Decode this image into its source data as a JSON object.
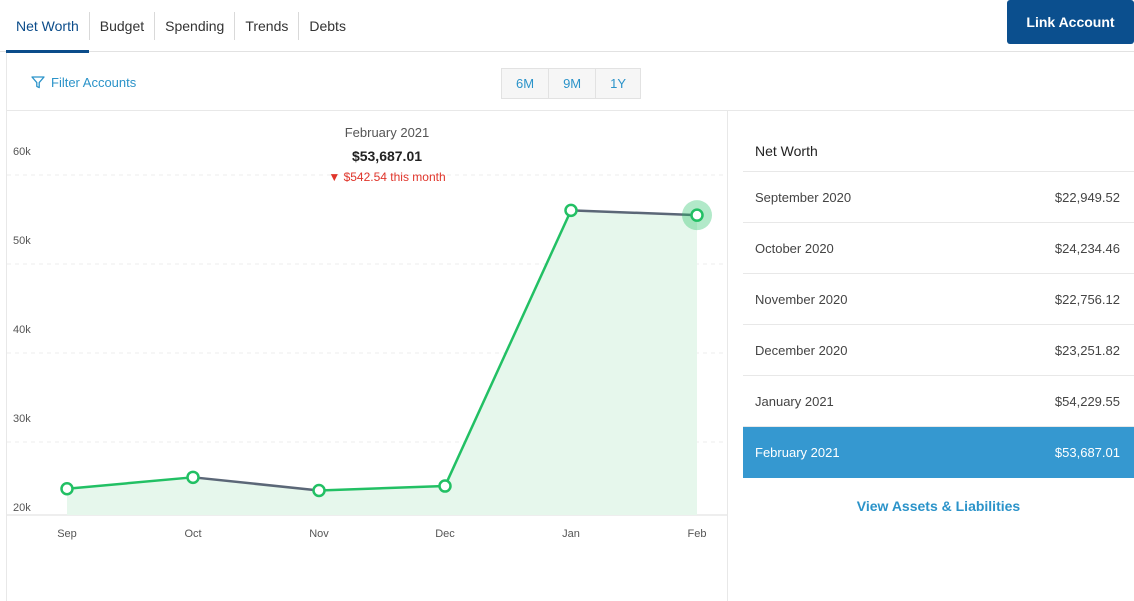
{
  "nav": {
    "tabs": [
      {
        "label": "Net Worth",
        "active": true
      },
      {
        "label": "Budget",
        "active": false
      },
      {
        "label": "Spending",
        "active": false
      },
      {
        "label": "Trends",
        "active": false
      },
      {
        "label": "Debts",
        "active": false
      }
    ],
    "link_account_label": "Link Account"
  },
  "toolbar": {
    "filter_label": "Filter Accounts",
    "filter_icon": "filter-icon",
    "ranges": [
      "6M",
      "9M",
      "1Y"
    ]
  },
  "chart_header": {
    "month": "February 2021",
    "value": "$53,687.01",
    "change": "$542.54 this month",
    "change_direction": "down"
  },
  "chart_data": {
    "type": "area",
    "categories": [
      "Sep",
      "Oct",
      "Nov",
      "Dec",
      "Jan",
      "Feb"
    ],
    "values": [
      22949.52,
      24234.46,
      22756.12,
      23251.82,
      54229.55,
      53687.01
    ],
    "y_ticks": [
      "20k",
      "30k",
      "40k",
      "50k",
      "60k"
    ],
    "ylim": [
      20000,
      60000
    ],
    "grid": true,
    "line_color_up": "#22c064",
    "line_color_down": "#5b6777",
    "fill_color": "#e6f7ec",
    "highlight_index": 5
  },
  "net_worth": {
    "title": "Net Worth",
    "rows": [
      {
        "month": "September 2020",
        "amount": "$22,949.52"
      },
      {
        "month": "October 2020",
        "amount": "$24,234.46"
      },
      {
        "month": "November 2020",
        "amount": "$22,756.12"
      },
      {
        "month": "December 2020",
        "amount": "$23,251.82"
      },
      {
        "month": "January 2021",
        "amount": "$54,229.55"
      },
      {
        "month": "February 2021",
        "amount": "$53,687.01",
        "selected": true
      }
    ],
    "view_link": "View Assets & Liabilities"
  },
  "colors": {
    "primary": "#0b4f8e",
    "accent": "#2b93c9",
    "selected_row": "#3598d0",
    "negative": "#e0352b"
  }
}
